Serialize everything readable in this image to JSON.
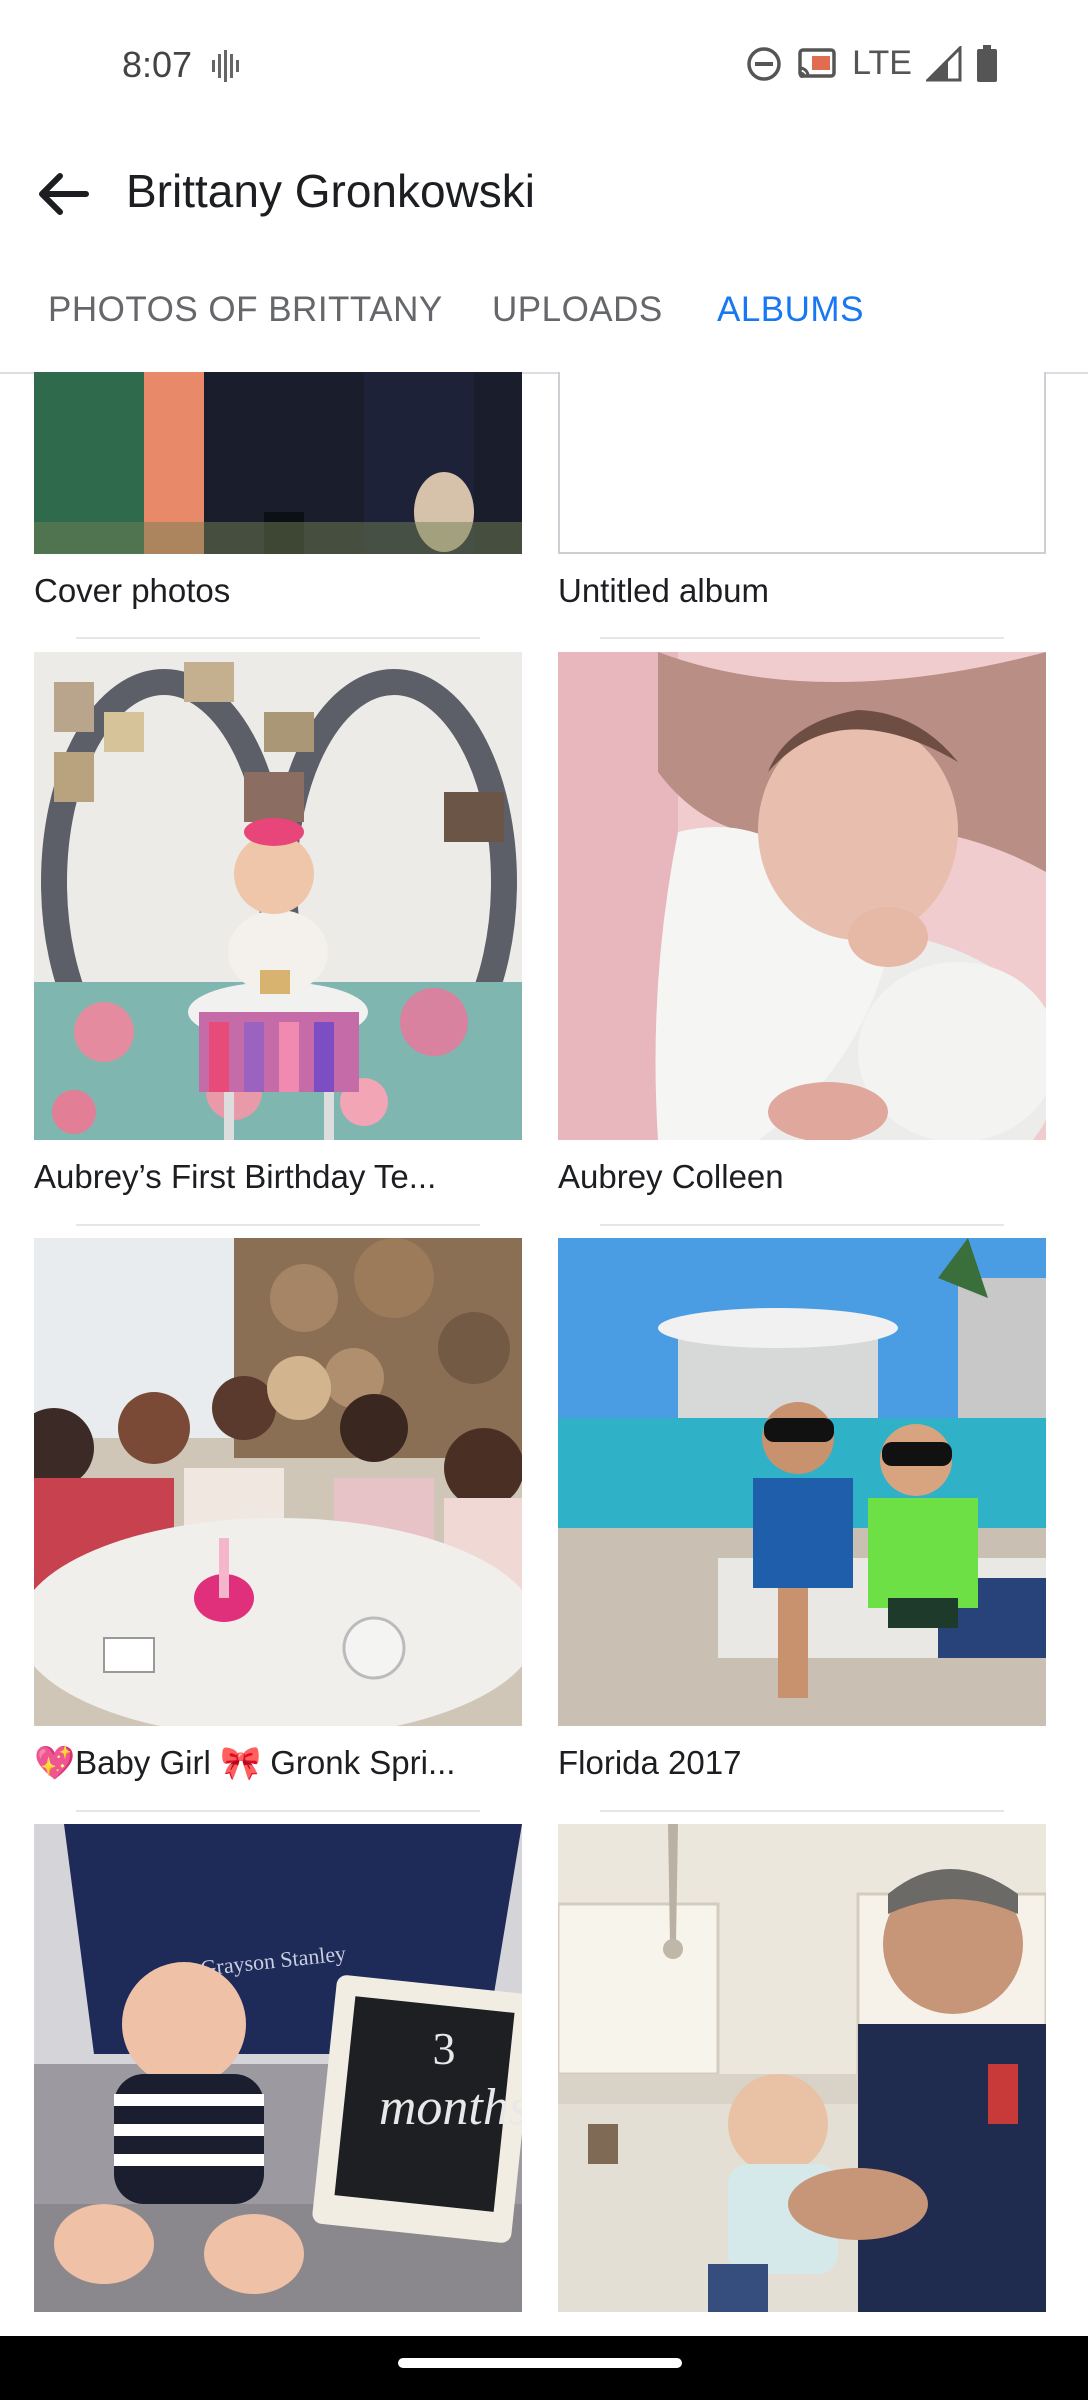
{
  "status": {
    "time": "8:07",
    "network": "LTE"
  },
  "header": {
    "title": "Brittany Gronkowski"
  },
  "tabs": [
    {
      "label": "PHOTOS OF BRITTANY",
      "active": false
    },
    {
      "label": "UPLOADS",
      "active": false
    },
    {
      "label": "ALBUMS",
      "active": true
    }
  ],
  "albums": [
    {
      "label": "Cover photos"
    },
    {
      "label": "Untitled album"
    },
    {
      "label": "Aubrey’s First Birthday Te..."
    },
    {
      "label": "Aubrey Colleen"
    },
    {
      "label": "💖Baby Girl 🎀 Gronk Spri..."
    },
    {
      "label": "Florida 2017"
    },
    {
      "label": ""
    },
    {
      "label": ""
    }
  ],
  "photo_text": {
    "blanket": "Grayson Stanley",
    "board_line1": "3",
    "board_line2": "months"
  },
  "colors": {
    "accent": "#1877f2"
  }
}
